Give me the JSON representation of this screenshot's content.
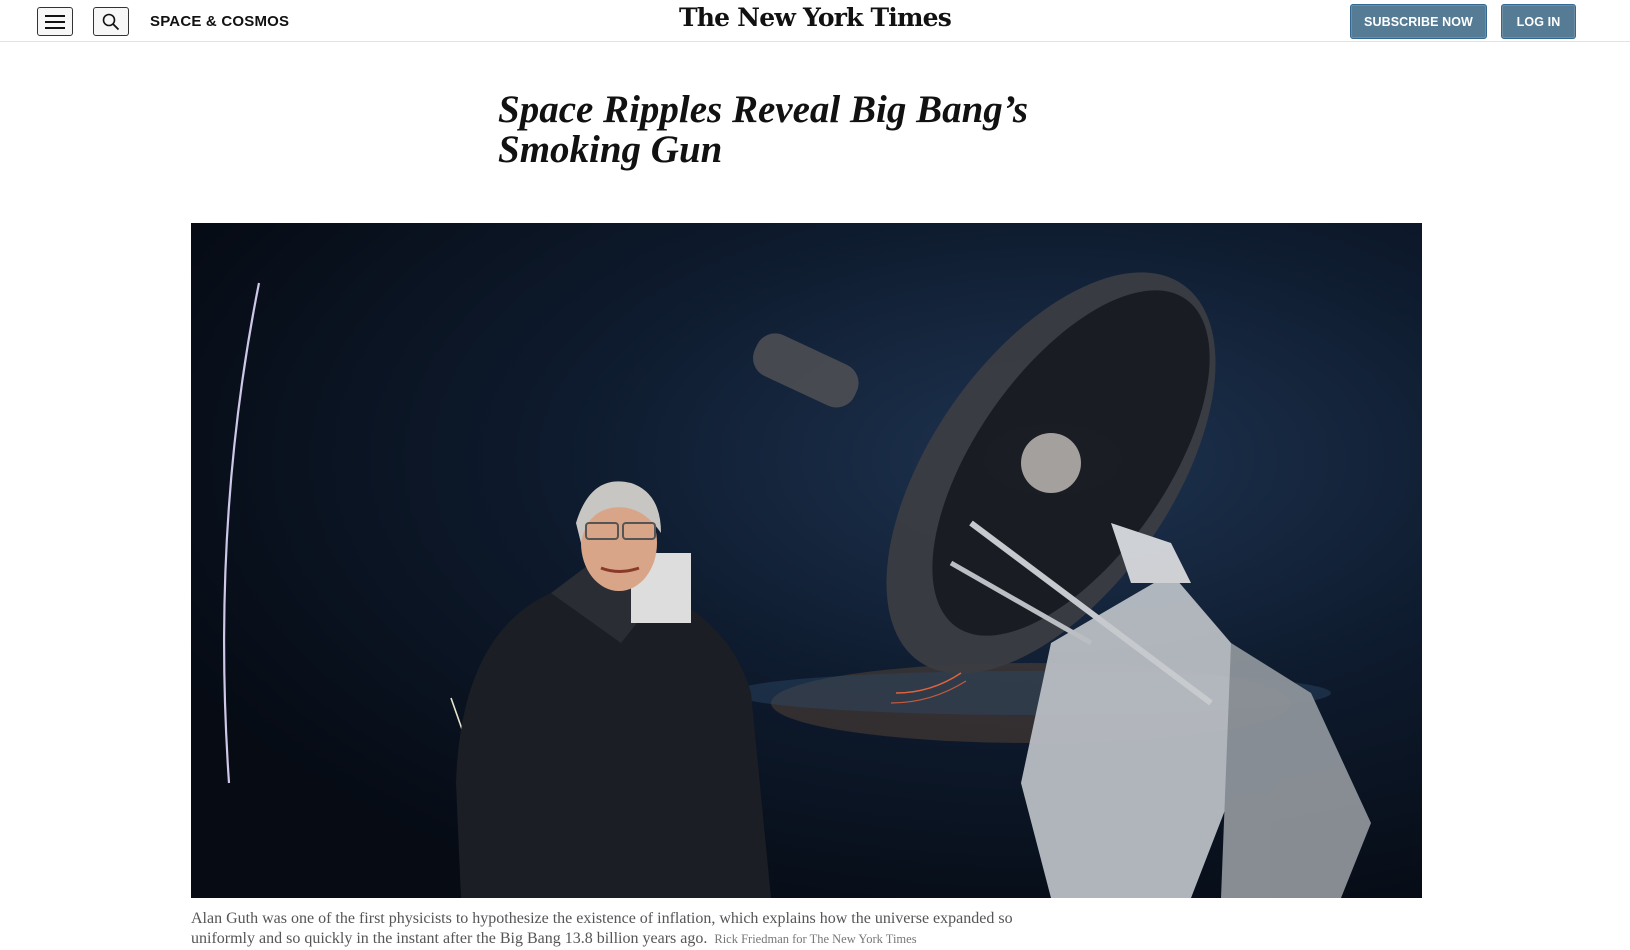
{
  "header": {
    "section_label": "SPACE & COSMOS",
    "logo_text": "The New York Times",
    "subscribe_label": "SUBSCRIBE NOW",
    "login_label": "LOG IN",
    "icons": [
      "hamburger-menu-icon",
      "search-icon"
    ]
  },
  "article": {
    "headline": "Space Ripples Reveal Big Bang’s Smoking Gun",
    "caption": "Alan Guth was one of the first physicists to hypothesize the existence of inflation, which explains how the universe expanded so uniformly and so quickly in the instant after the Big Bang 13.8 billion years ago.",
    "credit": "Rick Friedman for The New York Times"
  },
  "colors": {
    "button_blue": "#567b95",
    "text": "#121212",
    "caption_text": "#555555"
  }
}
